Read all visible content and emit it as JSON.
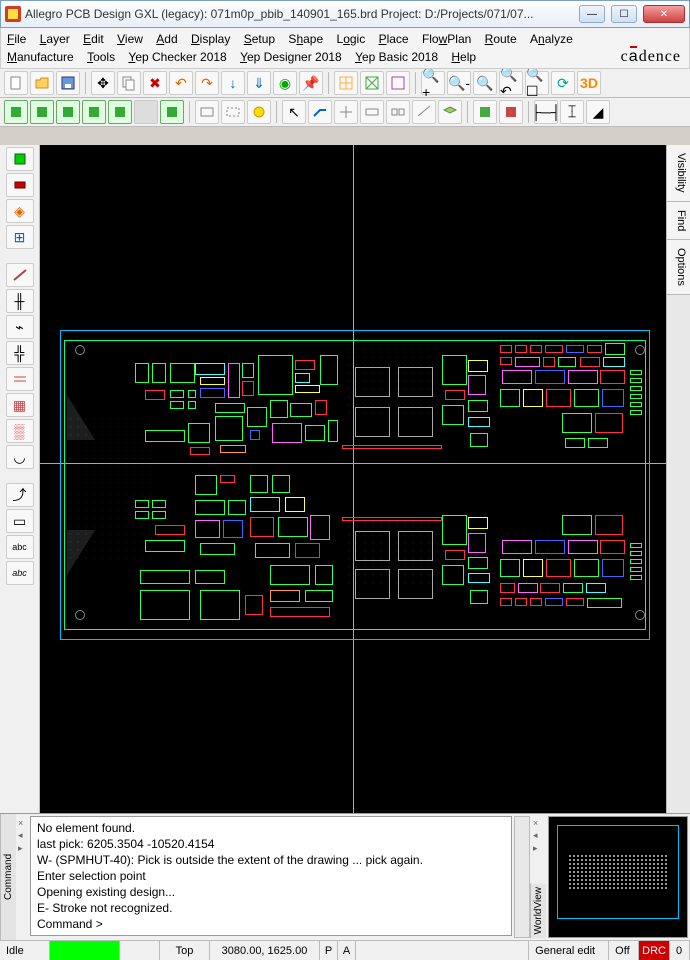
{
  "window": {
    "title": "Allegro PCB Design GXL (legacy): 071m0p_pbib_140901_165.brd   Project: D:/Projects/071/07..."
  },
  "menu": {
    "items": [
      "File",
      "Layer",
      "Edit",
      "View",
      "Add",
      "Display",
      "Setup",
      "Shape",
      "Logic",
      "Place",
      "FlowPlan",
      "Route",
      "Analyze",
      "Manufacture",
      "Tools",
      "Yep Checker 2018",
      "Yep Designer 2018",
      "Yep Basic 2018",
      "Help"
    ],
    "brand": "cādence"
  },
  "right_tabs": [
    "Visibility",
    "Find",
    "Options"
  ],
  "command": {
    "lines": [
      "No element found.",
      "last pick:  6205.3504 -10520.4154",
      "W- (SPMHUT-40): Pick is outside the extent of the drawing ... pick again.",
      "Enter selection point",
      "Opening existing design...",
      "E- Stroke not recognized.",
      "Command >"
    ]
  },
  "status": {
    "idle": "Idle",
    "layer": "Top",
    "coords": "3080.00, 1625.00",
    "mode_p": "P",
    "mode_a": "A",
    "edit_mode": "General edit",
    "drc_off": "Off",
    "drc": "DRC",
    "drc_count": "0"
  },
  "worldview_label": "WorldView",
  "command_label": "Command"
}
